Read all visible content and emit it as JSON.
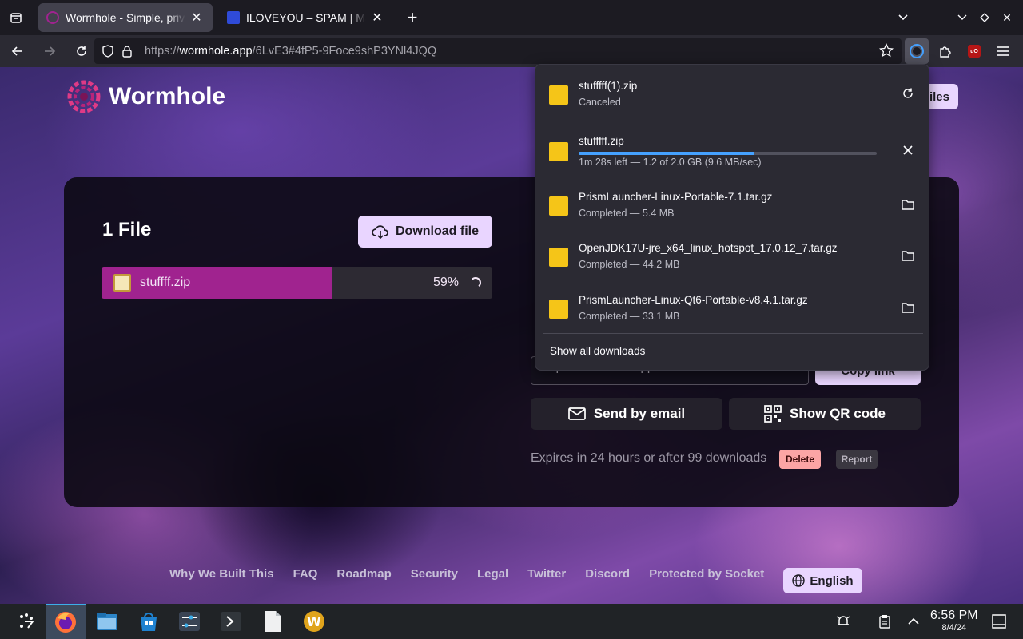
{
  "browser": {
    "tabs": [
      {
        "title": "Wormhole - Simple, private",
        "favicon_color": "#a0238f",
        "active": true
      },
      {
        "title": "ILOVEYOU – SPAM | Malwa",
        "favicon_color": "#2f4bd8",
        "active": false
      }
    ],
    "url_host": "https://wormhole.app",
    "url_path": "/6LvE3#4fP5-9Foce9shP3YNl4JQQ"
  },
  "page": {
    "brand": "Wormhole",
    "upload_btn_fragment": "iles",
    "files_title": "1 File",
    "download_btn": "Download file",
    "file": {
      "name": "stuffff.zip",
      "progress_label": "59%",
      "progress": 0.59
    },
    "share_input_value": "https://wormhole.app/6LvE3#4fP5-9Foce9shP3",
    "copy_link": "Copy link",
    "send_email": "Send by email",
    "show_qr": "Show QR code",
    "expiry": "Expires in 24 hours or after 99 downloads",
    "delete": "Delete",
    "report": "Report",
    "footer_links": [
      "Why We Built This",
      "FAQ",
      "Roadmap",
      "Security",
      "Legal",
      "Twitter",
      "Discord",
      "Protected by Socket"
    ],
    "language": "English"
  },
  "downloads": {
    "items": [
      {
        "name": "stufffff(1).zip",
        "status": "Canceled",
        "action": "retry-icon"
      },
      {
        "name": "stufffff.zip",
        "status": "1m 28s left — 1.2 of 2.0 GB (9.6 MB/sec)",
        "action": "cancel-icon",
        "progress": 0.59
      },
      {
        "name": "PrismLauncher-Linux-Portable-7.1.tar.gz",
        "status": "Completed — 5.4 MB",
        "action": "folder-icon"
      },
      {
        "name": "OpenJDK17U-jre_x64_linux_hotspot_17.0.12_7.tar.gz",
        "status": "Completed — 44.2 MB",
        "action": "folder-icon"
      },
      {
        "name": "PrismLauncher-Linux-Qt6-Portable-v8.4.1.tar.gz",
        "status": "Completed — 33.1 MB",
        "action": "folder-icon"
      }
    ],
    "show_all": "Show all downloads"
  },
  "taskbar": {
    "time": "6:56 PM",
    "date": "8/4/24"
  }
}
